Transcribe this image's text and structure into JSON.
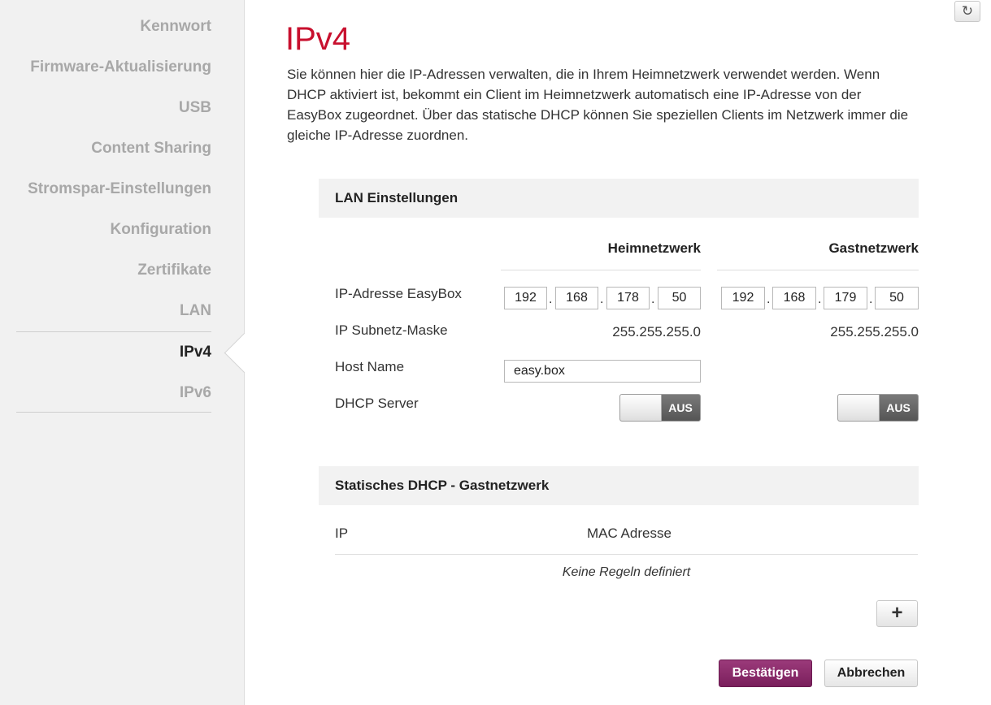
{
  "sidebar": {
    "items": [
      {
        "label": "Kennwort"
      },
      {
        "label": "Firmware-Aktualisierung"
      },
      {
        "label": "USB"
      },
      {
        "label": "Content Sharing"
      },
      {
        "label": "Stromspar-Einstellungen"
      },
      {
        "label": "Konfiguration"
      },
      {
        "label": "Zertifikate"
      },
      {
        "label": "LAN"
      },
      {
        "label": "IPv4",
        "active": true
      },
      {
        "label": "IPv6"
      }
    ]
  },
  "header": {
    "reset_icon": "refresh-icon",
    "title": "IPv4",
    "description": "Sie können hier die IP-Adressen verwalten, die in Ihrem Heimnetzwerk verwendet werden. Wenn DHCP aktiviert ist, bekommt ein Client im Heimnetzwerk automatisch eine IP-Adresse von der EasyBox zugeordnet. Über das statische DHCP können Sie speziellen Clients im Netzwerk immer die gleiche IP-Adresse zuordnen."
  },
  "lan": {
    "title": "LAN Einstellungen",
    "col_home": "Heimnetzwerk",
    "col_guest": "Gastnetzwerk",
    "ip_label": "IP-Adresse EasyBox",
    "mask_label": "IP Subnetz-Maske",
    "host_label": "Host Name",
    "dhcp_label": "DHCP Server",
    "home_ip": [
      "192",
      "168",
      "178",
      "50"
    ],
    "guest_ip": [
      "192",
      "168",
      "179",
      "50"
    ],
    "home_mask": "255.255.255.0",
    "guest_mask": "255.255.255.0",
    "host_name": "easy.box",
    "home_dhcp_state": "AUS",
    "guest_dhcp_state": "AUS",
    "ip_separator": "."
  },
  "static_dhcp": {
    "title": "Statisches DHCP - Gastnetzwerk",
    "col_ip": "IP",
    "col_mac": "MAC Adresse",
    "empty_text": "Keine Regeln definiert",
    "add_label": "+"
  },
  "actions": {
    "confirm_label": "Bestätigen",
    "cancel_label": "Abbrechen",
    "accent_color": "#7a1f5c"
  },
  "colors": {
    "title_red": "#c8102e",
    "sidebar_bg": "#f1f1f1"
  }
}
